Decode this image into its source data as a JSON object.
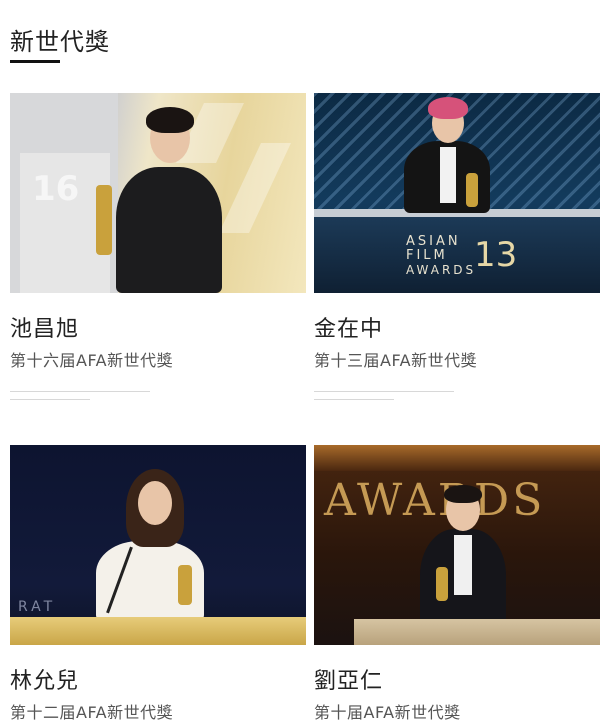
{
  "section": {
    "title": "新世代獎"
  },
  "cards": [
    {
      "name": "池昌旭",
      "desc": "第十六届AFA新世代獎",
      "photo_text": "16"
    },
    {
      "name": "金在中",
      "desc": "第十三届AFA新世代獎",
      "photo_text": "ASIAN FILM AWARDS 13"
    },
    {
      "name": "林允兒",
      "desc": "第十二届AFA新世代獎",
      "photo_text": "RAT"
    },
    {
      "name": "劉亞仁",
      "desc": "第十届AFA新世代獎",
      "photo_text": "AWARDS"
    }
  ],
  "photo_labels": {
    "p1_num": "16",
    "p2_line1": "ASIAN",
    "p2_line2": "FILM",
    "p2_line3": "AWARDS",
    "p2_num": "13",
    "p3_text": "RAT",
    "p4_text": "AWARDS"
  }
}
